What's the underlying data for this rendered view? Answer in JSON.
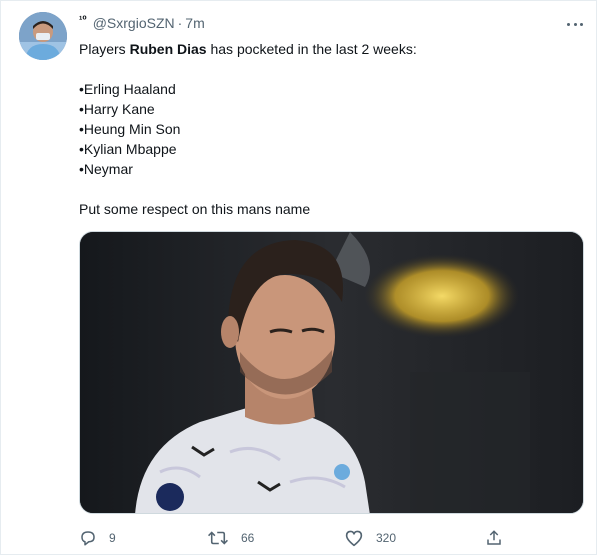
{
  "tweet": {
    "nick_marker": "¹⁰",
    "handle": "@SxrgioSZN",
    "separator": "·",
    "time": "7m",
    "text_lead": "Players ",
    "text_bold": "Ruben Dias",
    "text_rest": " has pocketed in the last 2 weeks:",
    "list": [
      "•Erling Haaland",
      "•Harry Kane",
      "•Heung Min Son",
      "•Kylian Mbappe",
      "•Neymar"
    ],
    "closing": "Put some respect on this mans name"
  },
  "actions": {
    "reply_count": "9",
    "retweet_count": "66",
    "like_count": "320"
  },
  "icons": {
    "more": "more-horizontal-icon",
    "reply": "reply-icon",
    "retweet": "retweet-icon",
    "like": "heart-icon",
    "share": "share-icon"
  },
  "colors": {
    "text": "#0f1419",
    "secondary": "#536471",
    "border": "#e6ecf0"
  }
}
